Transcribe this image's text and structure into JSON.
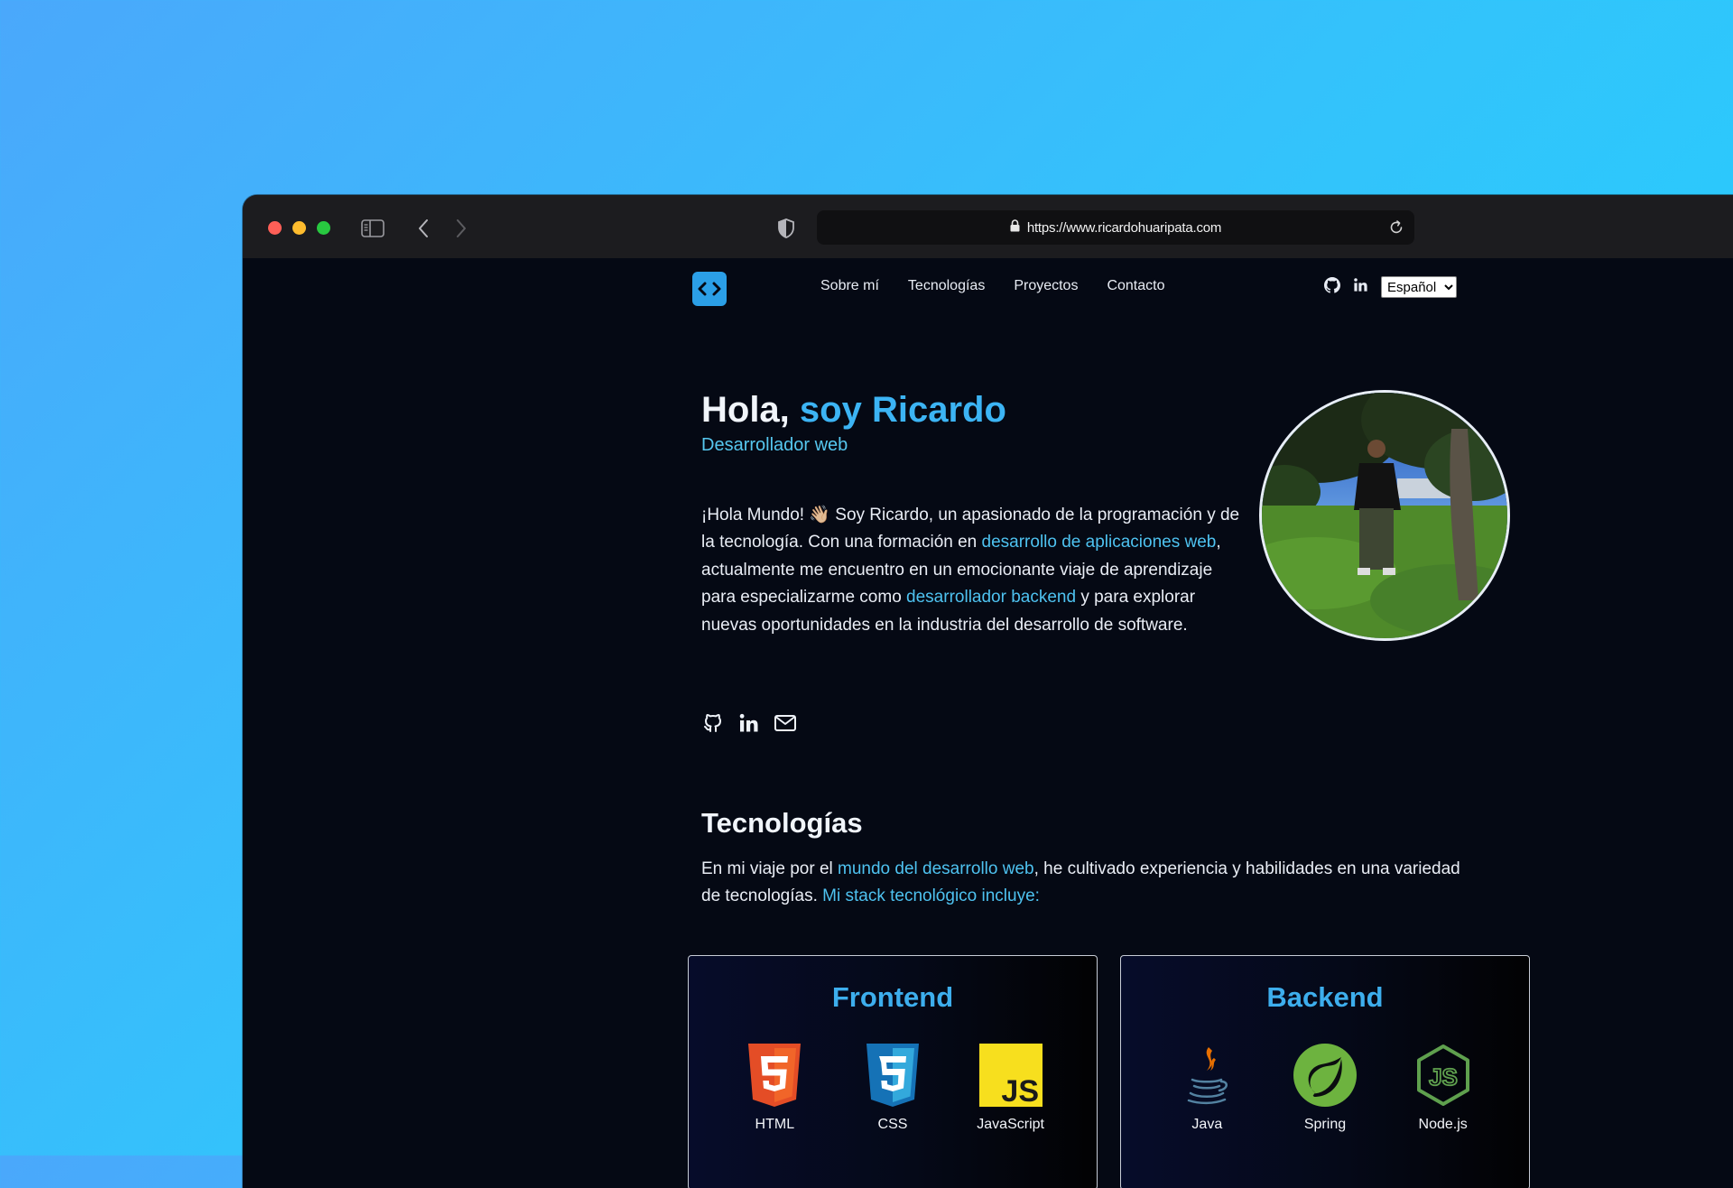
{
  "browser": {
    "url": "https://www.ricardohuaripata.com"
  },
  "nav": {
    "links": [
      "Sobre mí",
      "Tecnologías",
      "Proyectos",
      "Contacto"
    ],
    "language": "Español"
  },
  "hero": {
    "greeting": "Hola,",
    "name": "soy Ricardo",
    "subtitle": "Desarrollador web",
    "intro_1": "¡Hola Mundo! 👋🏼 Soy Ricardo, un apasionado de la programación y de la tecnología. Con una formación en ",
    "intro_link_1": "desarrollo de aplicaciones web",
    "intro_2": ", actualmente me encuentro en un emocionante viaje de aprendizaje para especializarme como ",
    "intro_link_2": "desarrollador backend",
    "intro_3": " y para explorar nuevas oportunidades en la industria del desarrollo de software."
  },
  "tech": {
    "title": "Tecnologías",
    "desc_1": "En mi viaje por el ",
    "desc_link_1": "mundo del desarrollo web",
    "desc_2": ", he cultivado experiencia y habilidades en una variedad de tecnologías. ",
    "desc_link_2": "Mi stack tecnológico incluye:",
    "frontend": {
      "title": "Frontend",
      "items": [
        {
          "label": "HTML",
          "icon": "html5-icon"
        },
        {
          "label": "CSS",
          "icon": "css3-icon"
        },
        {
          "label": "JavaScript",
          "icon": "javascript-icon"
        }
      ]
    },
    "backend": {
      "title": "Backend",
      "items": [
        {
          "label": "Java",
          "icon": "java-icon"
        },
        {
          "label": "Spring",
          "icon": "spring-icon"
        },
        {
          "label": "Node.js",
          "icon": "nodejs-icon"
        }
      ]
    }
  },
  "colors": {
    "accent": "#3cb4f4",
    "link": "#4ec2f0",
    "page_bg": "#050914",
    "logo_bg": "#2b9fe7"
  }
}
